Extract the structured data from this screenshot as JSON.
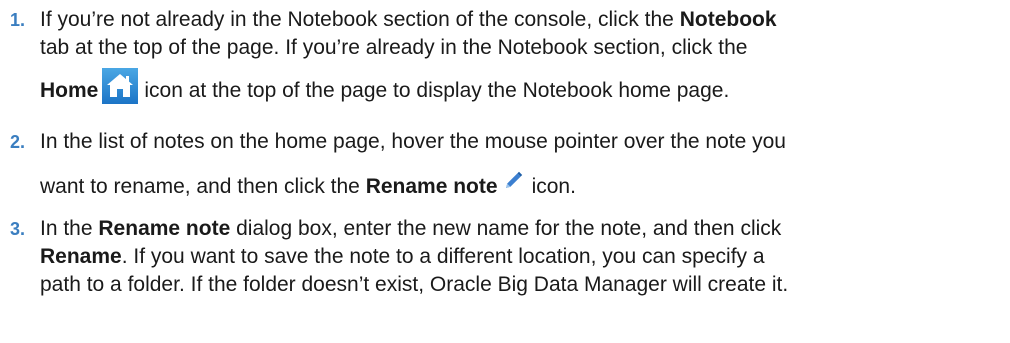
{
  "steps": [
    {
      "number": "1.",
      "line1_before": "If you’re not already in the Notebook section of the console, click the ",
      "line1_bold": "Notebook",
      "line2": "tab at the top of the page. If you’re already in the Notebook section, click the",
      "line3_bold": "Home",
      "home_icon": "home-icon",
      "line3_after": "icon at the top of the page to display the Notebook home page."
    },
    {
      "number": "2.",
      "line1": "In the list of notes on the home page, hover the mouse pointer over the note you",
      "line2_before": "want to rename, and then click the ",
      "line2_bold": "Rename note",
      "pencil_icon": "pencil-icon",
      "line2_after": "icon."
    },
    {
      "number": "3.",
      "line1_before": "In the ",
      "line1_bold": "Rename note",
      "line1_after": " dialog box, enter the new name for the note, and then click",
      "line2_bold": "Rename",
      "line2_after": ". If you want to save the note to a different location, you can specify a",
      "line3": "path to a folder. If the folder doesn’t exist, Oracle Big Data Manager will create it."
    }
  ],
  "colors": {
    "step_number": "#3a7ec0",
    "home_icon_bg": "#2a86d4",
    "pencil": "#3b7fd0"
  }
}
